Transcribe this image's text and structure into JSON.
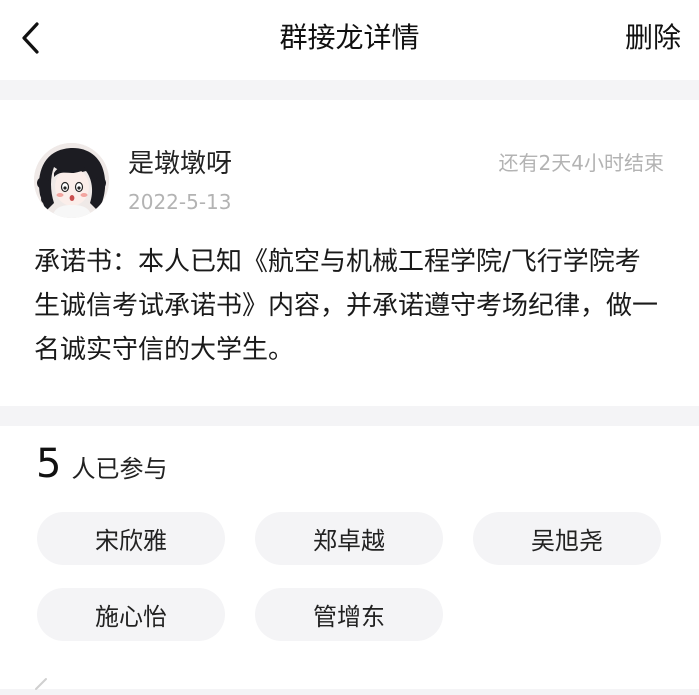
{
  "nav": {
    "title": "群接龙详情",
    "delete_label": "删除",
    "back_icon": "chevron-left-icon"
  },
  "post": {
    "author": "是墩墩呀",
    "date": "2022-5-13",
    "time_remaining": "还有2天4小时结束",
    "content": "承诺书：本人已知《航空与机械工程学院/飞行学院考生诚信考试承诺书》内容，并承诺遵守考场纪律，做一名诚实守信的大学生。"
  },
  "participants": {
    "count": "5",
    "label": "人已参与",
    "names": [
      "宋欣雅",
      "郑卓越",
      "吴旭尧",
      "施心怡",
      "管增东"
    ]
  },
  "colors": {
    "background": "#f4f4f6",
    "card": "#ffffff",
    "muted_text": "#b3b3b3",
    "pill": "#f4f4f6"
  }
}
